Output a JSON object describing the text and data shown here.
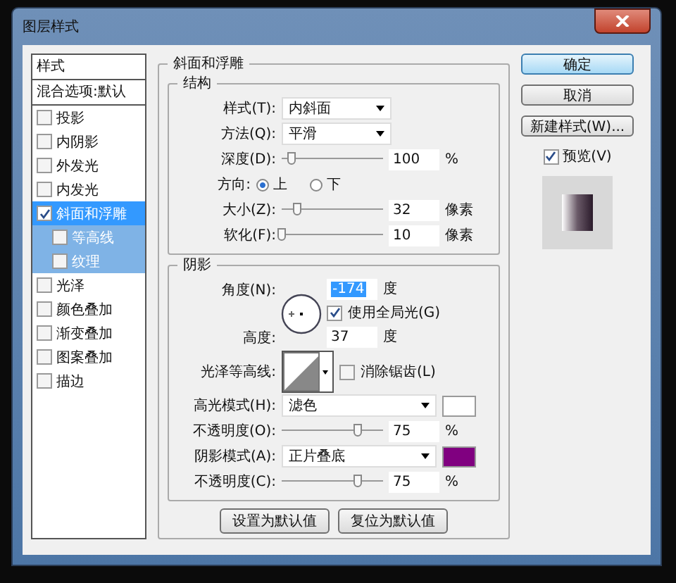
{
  "window": {
    "title": "图层样式"
  },
  "sidebar": {
    "header": "样式",
    "blend": "混合选项:默认",
    "items": [
      {
        "label": "投影",
        "checked": false,
        "selected": false
      },
      {
        "label": "内阴影",
        "checked": false,
        "selected": false
      },
      {
        "label": "外发光",
        "checked": false,
        "selected": false
      },
      {
        "label": "内发光",
        "checked": false,
        "selected": false
      },
      {
        "label": "斜面和浮雕",
        "checked": true,
        "selected": true,
        "children": [
          {
            "label": "等高线",
            "checked": false,
            "selected": false
          },
          {
            "label": "纹理",
            "checked": false,
            "selected": false
          }
        ]
      },
      {
        "label": "光泽",
        "checked": false,
        "selected": false
      },
      {
        "label": "颜色叠加",
        "checked": false,
        "selected": false
      },
      {
        "label": "渐变叠加",
        "checked": false,
        "selected": false
      },
      {
        "label": "图案叠加",
        "checked": false,
        "selected": false
      },
      {
        "label": "描边",
        "checked": false,
        "selected": false
      }
    ]
  },
  "bevel": {
    "title": "斜面和浮雕",
    "structure": {
      "title": "结构",
      "style": {
        "label": "样式(T):",
        "value": "内斜面"
      },
      "technique": {
        "label": "方法(Q):",
        "value": "平滑"
      },
      "depth": {
        "label": "深度(D):",
        "level": 0.1,
        "value": "100",
        "unit": "%"
      },
      "direction": {
        "label": "方向:",
        "options": [
          {
            "label": "上",
            "selected": true
          },
          {
            "label": "下",
            "selected": false
          }
        ]
      },
      "size": {
        "label": "大小(Z):",
        "level": 0.15,
        "value": "32",
        "unit": "像素"
      },
      "soften": {
        "label": "软化(F):",
        "level": 0,
        "value": "10",
        "unit": "像素"
      }
    },
    "shading": {
      "title": "阴影",
      "angle": {
        "label": "角度(N):",
        "value": "-174",
        "unit": "度"
      },
      "global_light": {
        "label": "使用全局光(G)",
        "checked": true
      },
      "altitude": {
        "label": "高度:",
        "value": "37",
        "unit": "度"
      },
      "gloss_contour": {
        "label": "光泽等高线:"
      },
      "anti_alias": {
        "label": "消除锯齿(L)",
        "checked": false
      },
      "highlight_mode": {
        "label": "高光模式(H):",
        "value": "滤色",
        "color": "#ffffff"
      },
      "highlight_opacity": {
        "label": "不透明度(O):",
        "level": 0.75,
        "value": "75",
        "unit": "%"
      },
      "shadow_mode": {
        "label": "阴影模式(A):",
        "value": "正片叠底",
        "color": "#800080"
      },
      "shadow_opacity": {
        "label": "不透明度(C):",
        "level": 0.75,
        "value": "75",
        "unit": "%"
      }
    },
    "buttons": [
      "设置为默认值",
      "复位为默认值"
    ]
  },
  "actions": [
    {
      "label": "确定",
      "default": true
    },
    {
      "label": "取消",
      "default": false
    },
    {
      "label": "新建样式(W)...",
      "default": false
    }
  ],
  "preview": {
    "label": "预览(V)",
    "checked": true
  }
}
